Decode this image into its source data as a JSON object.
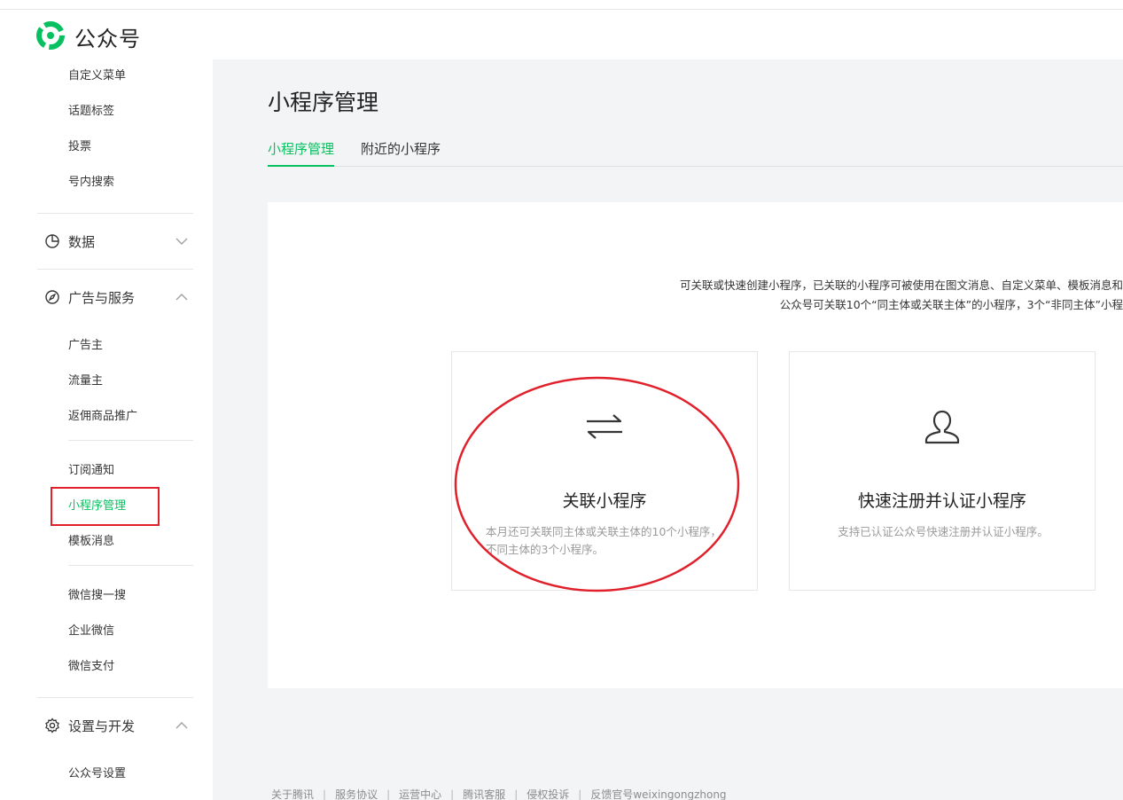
{
  "header": {
    "brand": "公众号"
  },
  "sidebar": {
    "top_items": [
      "自定义菜单",
      "话题标签",
      "投票",
      "号内搜索"
    ],
    "groups": {
      "data": {
        "label": "数据"
      },
      "ads": {
        "label": "广告与服务"
      },
      "settings": {
        "label": "设置与开发"
      }
    },
    "ads_items": [
      "广告主",
      "流量主",
      "返佣商品推广"
    ],
    "ads_items2": [
      "订阅通知",
      "小程序管理",
      "模板消息"
    ],
    "ads_items3": [
      "微信搜一搜",
      "企业微信",
      "微信支付"
    ],
    "settings_items": [
      "公众号设置"
    ],
    "active_item": "小程序管理"
  },
  "main": {
    "title": "小程序管理",
    "tabs": [
      "小程序管理",
      "附近的小程序"
    ],
    "desc_line1": "可关联或快速创建小程序，已关联的小程序可被使用在图文消息、自定义菜单、模板消息和",
    "desc_line2": "公众号可关联10个“同主体或关联主体”的小程序，3个“非同主体”小程",
    "cards": [
      {
        "title": "关联小程序",
        "desc": "本月还可关联同主体或关联主体的10个小程序，不同主体的3个小程序。",
        "icon": "transfer-arrows-icon"
      },
      {
        "title": "快速注册并认证小程序",
        "desc": "支持已认证公众号快速注册并认证小程序。",
        "icon": "user-icon"
      }
    ]
  },
  "footer": {
    "links": [
      "关于腾讯",
      "服务协议",
      "运营中心",
      "腾讯客服",
      "侵权投诉",
      "反馈官号weixingongzhong"
    ]
  },
  "colors": {
    "accent": "#07c160",
    "highlight": "#e0202a"
  }
}
